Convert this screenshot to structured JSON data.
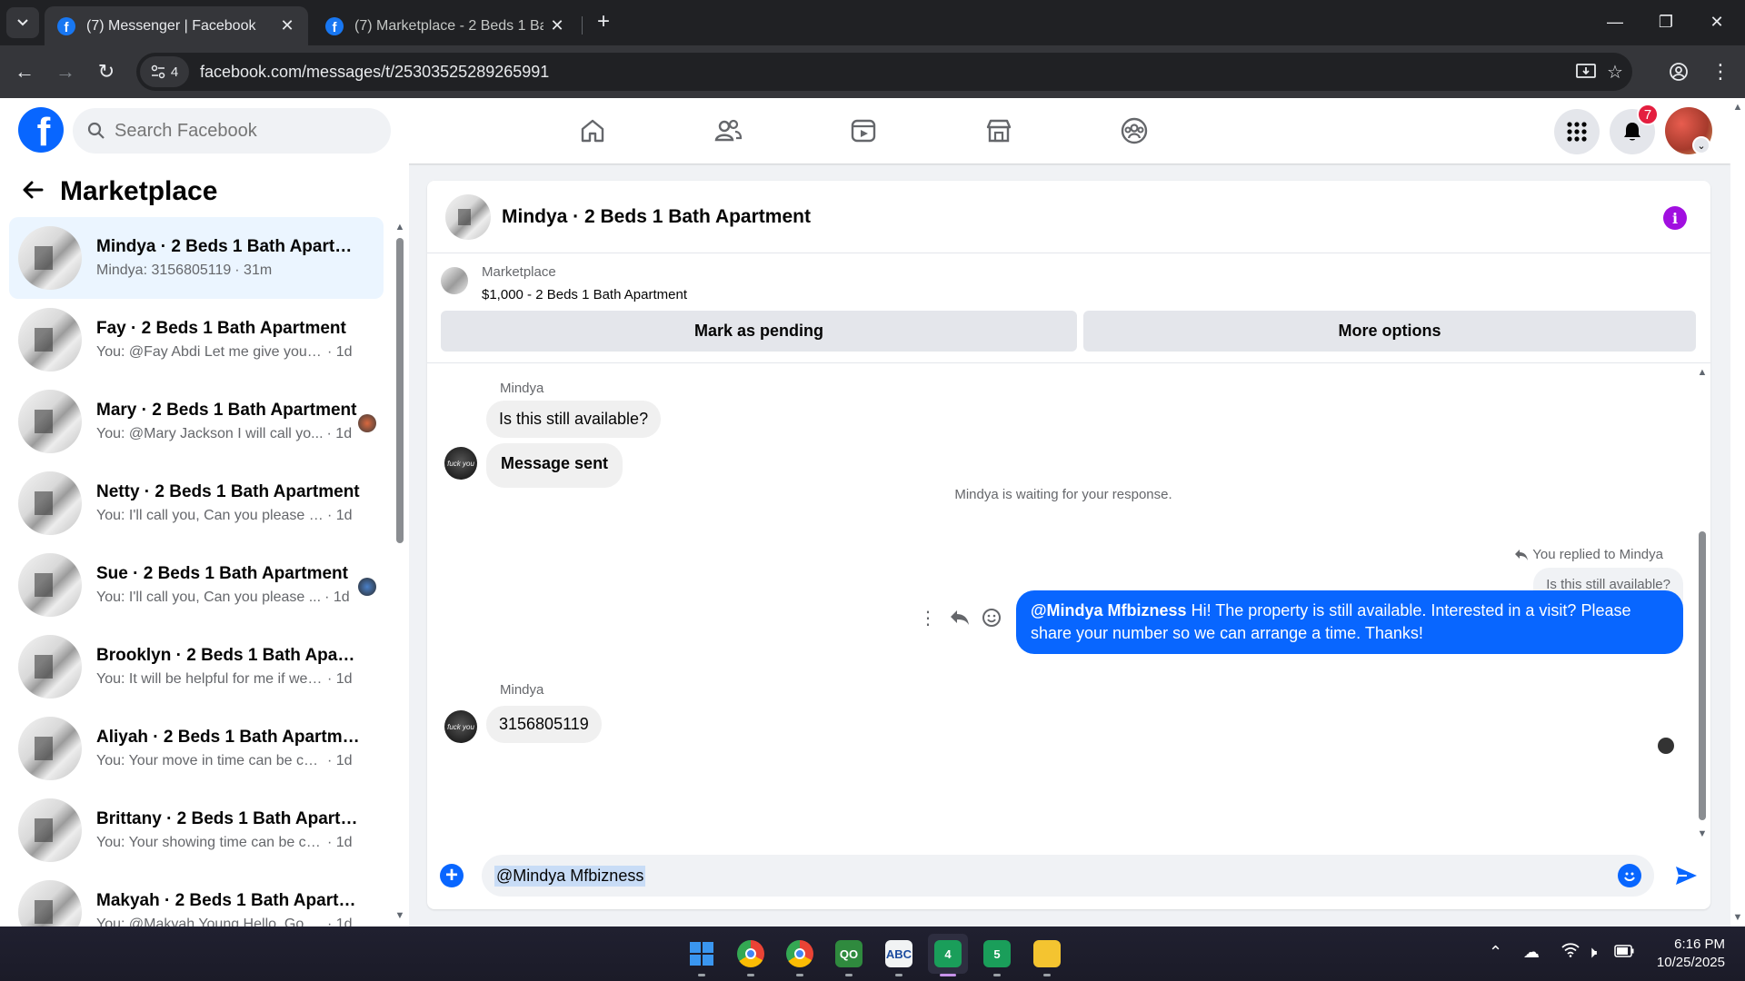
{
  "browser": {
    "tabs": [
      {
        "title": "(7) Messenger | Facebook",
        "active": true
      },
      {
        "title": "(7) Marketplace - 2 Beds 1 Bath",
        "active": false
      }
    ],
    "site_badge": "4",
    "url": "facebook.com/messages/t/25303525289265991"
  },
  "fb_header": {
    "search_placeholder": "Search Facebook",
    "notification_count": "7",
    "nav_icons": [
      "home-icon",
      "friends-icon",
      "video-icon",
      "marketplace-icon",
      "groups-icon"
    ]
  },
  "sidebar": {
    "title": "Marketplace",
    "conversations": [
      {
        "name": "Mindya · 2 Beds 1 Bath Apartment",
        "snippet": "Mindya: 3156805119",
        "time": "· 31m",
        "selected": true,
        "avatar": false
      },
      {
        "name": "Fay · 2 Beds 1 Bath Apartment",
        "snippet": "You: @Fay Abdi Let me give you a ...",
        "time": "· 1d",
        "selected": false,
        "avatar": false
      },
      {
        "name": "Mary · 2 Beds 1 Bath Apartment",
        "snippet": "You: @Mary Jackson I will call yo...",
        "time": "· 1d",
        "selected": false,
        "avatar": true
      },
      {
        "name": "Netty · 2 Beds 1 Bath Apartment",
        "snippet": "You: I'll call you, Can you please sh...",
        "time": "· 1d",
        "selected": false,
        "avatar": false
      },
      {
        "name": "Sue · 2 Beds 1 Bath Apartment",
        "snippet": "You: I'll call you, Can you please ...",
        "time": "· 1d",
        "selected": false,
        "avatar": true
      },
      {
        "name": "Brooklyn · 2 Beds 1 Bath Apartm...",
        "snippet": "You: It will be helpful for me if we c...",
        "time": "· 1d",
        "selected": false,
        "avatar": false
      },
      {
        "name": "Aliyah · 2 Beds 1 Bath Apartment",
        "snippet": "You: Your move in time can be conf...",
        "time": "· 1d",
        "selected": false,
        "avatar": false
      },
      {
        "name": "Brittany · 2 Beds 1 Bath Apartme...",
        "snippet": "You: Your showing time can be con...",
        "time": "· 1d",
        "selected": false,
        "avatar": false
      },
      {
        "name": "Makyah · 2 Beds 1 Bath Apartme...",
        "snippet": "You: @Makyah Young Hello, Good ...",
        "time": "· 1d",
        "selected": false,
        "avatar": false
      }
    ]
  },
  "chat": {
    "title": "Mindya · 2 Beds 1 Bath Apartment",
    "listing": {
      "label": "Marketplace",
      "price_title": "$1,000 - 2 Beds 1 Bath Apartment",
      "primary_button": "Mark as pending",
      "secondary_button": "More options"
    },
    "messages": {
      "sender_1": "Mindya",
      "incoming_1": "Is this still available?",
      "incoming_2": "Message sent",
      "waiting_notice": "Mindya is waiting for your response.",
      "replied_label": "You replied to Mindya",
      "quoted": "Is this still available?",
      "outgoing_mention": "@Mindya Mfbizness",
      "outgoing_text": " Hi! The property is still available. Interested in a visit? Please share your number so we can arrange a time. Thanks!",
      "sender_2": "Mindya",
      "incoming_3": "3156805119"
    },
    "composer_value": "@Mindya Mfbizness"
  },
  "taskbar": {
    "time": "6:16 PM",
    "date": "10/25/2025",
    "apps": [
      {
        "name": "windows-start",
        "color": "#3a96f0",
        "label": ""
      },
      {
        "name": "chrome",
        "color": "#e8453c",
        "label": ""
      },
      {
        "name": "chrome-profile",
        "color": "#34a853",
        "label": ""
      },
      {
        "name": "app-qo",
        "color": "#2f8a3e",
        "label": "QO"
      },
      {
        "name": "app-abc",
        "color": "#f1f3f4",
        "label": "ABC"
      },
      {
        "name": "app-4",
        "color": "#1a9e5a",
        "label": "4"
      },
      {
        "name": "app-5",
        "color": "#1a9e5a",
        "label": "5"
      },
      {
        "name": "file-explorer",
        "color": "#f4c430",
        "label": ""
      }
    ]
  },
  "colors": {
    "fb_blue": "#0866ff",
    "badge_red": "#e41e3f",
    "info_purple": "#a10fe0",
    "selected_bg": "#ebf5ff"
  }
}
